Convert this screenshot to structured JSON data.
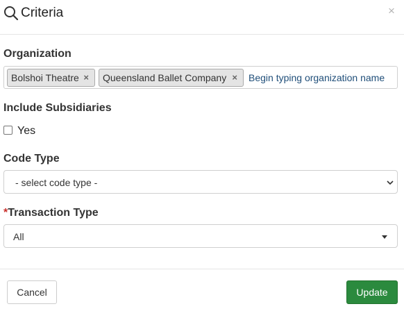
{
  "header": {
    "title": "Criteria",
    "close_label": "×"
  },
  "organization": {
    "label": "Organization",
    "chips": [
      {
        "label": "Bolshoi Theatre",
        "remove": "×"
      },
      {
        "label": "Queensland Ballet Company",
        "remove": "×"
      }
    ],
    "placeholder": "Begin typing organization name"
  },
  "subsidiaries": {
    "label": "Include Subsidiaries",
    "option_label": "Yes",
    "checked": false
  },
  "code_type": {
    "label": "Code Type",
    "selected": "- select code type -"
  },
  "transaction_type": {
    "required_mark": "*",
    "label": "Transaction Type",
    "selected": "All"
  },
  "footer": {
    "cancel_label": "Cancel",
    "update_label": "Update"
  },
  "colors": {
    "primary": "#2b8a3e",
    "required": "#c9302c",
    "link": "#1f4e79"
  }
}
